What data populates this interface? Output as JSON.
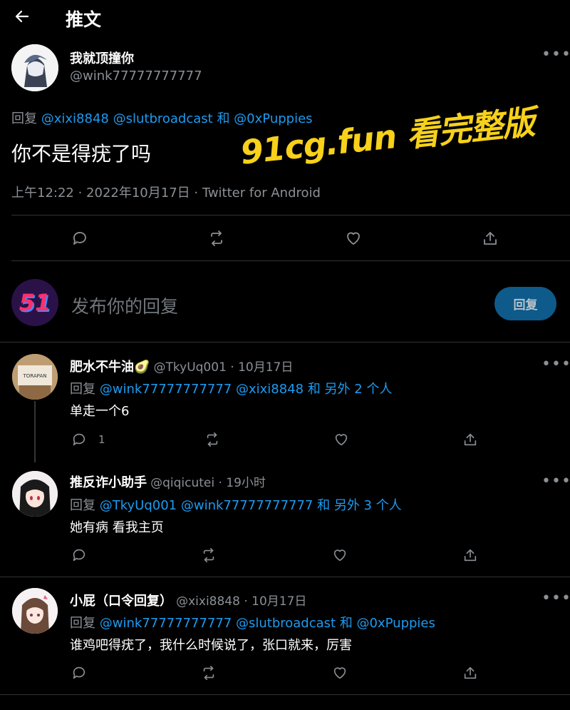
{
  "header": {
    "title": "推文"
  },
  "main_tweet": {
    "display_name": "我就顶撞你",
    "handle": "@wink77777777777",
    "reply_prefix": "回复",
    "reply_to": [
      "@xixi8848",
      "@slutbroadcast"
    ],
    "reply_and": "和",
    "reply_to_last": "@0xPuppies",
    "text": "你不是得疣了吗",
    "timestamp": "上午12:22 · 2022年10月17日 · Twitter for Android"
  },
  "watermark": {
    "text": "91cg.fun 看完整版"
  },
  "compose": {
    "placeholder": "发布你的回复",
    "button_label": "回复",
    "avatar_text": "51"
  },
  "replies": [
    {
      "display_name": "肥水不牛油🥑",
      "handle_time": "@TkyUq001 · 10月17日",
      "reply_prefix": "回复",
      "reply_to": "@wink77777777777 @xixi8848 和 另外 2 个人",
      "text": "单走一个6",
      "reply_count": "1",
      "avatar_label": "TORAPAN"
    },
    {
      "display_name": "推反诈小助手",
      "handle_time": "@qiqicutei · 19小时",
      "reply_prefix": "回复",
      "reply_to": "@TkyUq001 @wink77777777777 和 另外 3 个人",
      "text": "她有病 看我主页",
      "reply_count": ""
    },
    {
      "display_name": "小屁（口令回复）",
      "handle_time": "@xixi8848 · 10月17日",
      "reply_prefix": "回复",
      "reply_to": "@wink77777777777 @slutbroadcast 和 @0xPuppies",
      "text": "谁鸡吧得疣了，我什么时候说了，张口就来，厉害",
      "reply_count": ""
    }
  ],
  "icons": [
    "back-arrow-icon",
    "more-icon",
    "reply-icon",
    "retweet-icon",
    "like-icon",
    "share-icon"
  ],
  "colors": {
    "background": "#000000",
    "link": "#1d9bf0",
    "muted": "#8b9095",
    "watermark": "#f7d11a",
    "reply_button": "#0e5a8a"
  }
}
